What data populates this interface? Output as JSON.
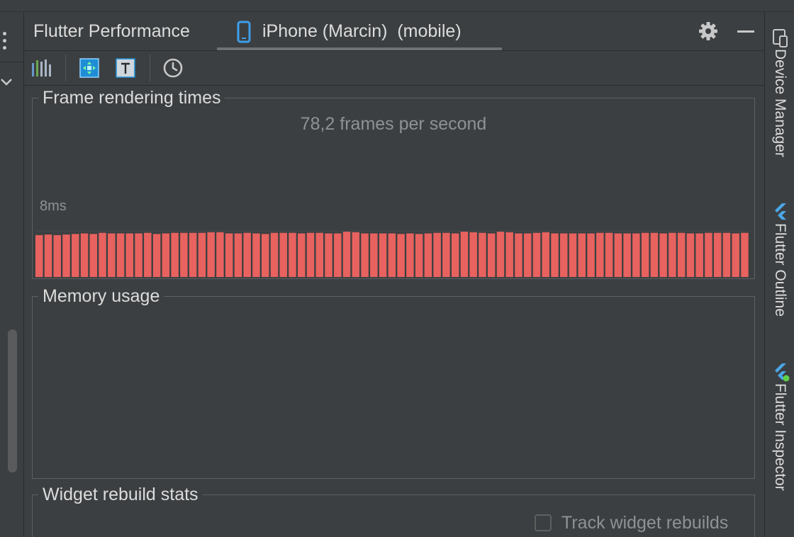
{
  "window": {
    "tool_title": "Flutter Performance",
    "device_tab": "iPhone (Marcin)  (mobile)"
  },
  "toolbar": {
    "icons": [
      "bar-chart-icon",
      "performance-overlay-icon",
      "text-baseline-icon",
      "clock-icon"
    ]
  },
  "frames_panel": {
    "title": "Frame rendering times",
    "fps_text": "78,2 frames per second",
    "threshold_label": "8ms",
    "bar_color": "#e8625f"
  },
  "memory_panel": {
    "title": "Memory usage"
  },
  "rebuild_panel": {
    "title": "Widget rebuild stats",
    "track_label": "Track widget rebuilds",
    "track_checked": false
  },
  "right_stripe": {
    "items": [
      {
        "label": "Device Manager",
        "icon": "device-manager-icon"
      },
      {
        "label": "Flutter Outline",
        "icon": "flutter-outline-icon"
      },
      {
        "label": "Flutter Inspector",
        "icon": "flutter-inspector-icon"
      }
    ]
  },
  "chart_data": {
    "type": "bar",
    "y_unit": "ms",
    "threshold_ms": 8,
    "values": [
      7.3,
      7.4,
      7.3,
      7.4,
      7.5,
      7.6,
      7.5,
      7.7,
      7.6,
      7.6,
      7.6,
      7.6,
      7.7,
      7.5,
      7.6,
      7.7,
      7.7,
      7.7,
      7.7,
      7.8,
      7.8,
      7.6,
      7.6,
      7.7,
      7.6,
      7.5,
      7.7,
      7.7,
      7.7,
      7.6,
      7.7,
      7.7,
      7.6,
      7.6,
      7.9,
      7.8,
      7.6,
      7.6,
      7.6,
      7.6,
      7.5,
      7.6,
      7.5,
      7.6,
      7.7,
      7.7,
      7.6,
      7.9,
      7.8,
      7.7,
      7.6,
      7.9,
      7.8,
      7.6,
      7.6,
      7.7,
      7.8,
      7.6,
      7.6,
      7.6,
      7.6,
      7.6,
      7.7,
      7.7,
      7.6,
      7.6,
      7.6,
      7.7,
      7.7,
      7.6,
      7.7,
      7.7,
      7.6,
      7.6,
      7.7,
      7.7,
      7.7,
      7.6,
      7.7
    ],
    "ylim": [
      0,
      12.6
    ]
  }
}
